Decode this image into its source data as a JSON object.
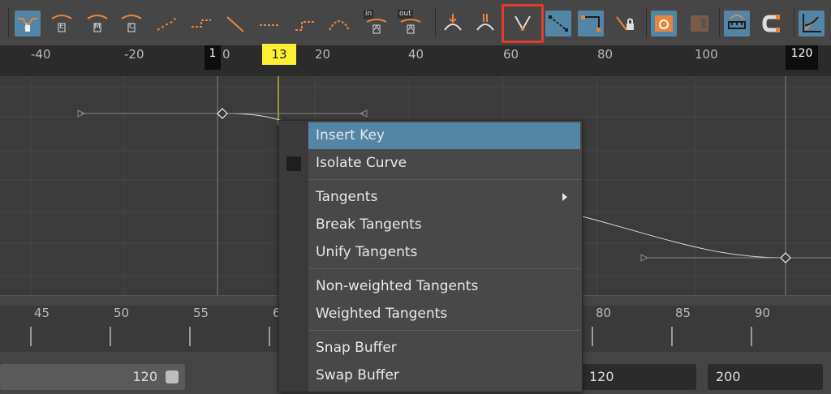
{
  "toolbar": {
    "tools": [
      {
        "icon": "key-tangent-auto-icon",
        "label": "A",
        "active": true
      },
      {
        "icon": "key-tangent-spline-icon",
        "label": "E",
        "active": false
      },
      {
        "icon": "key-tangent-clamped-icon",
        "label": "M",
        "active": false
      },
      {
        "icon": "key-tangent-linear-icon",
        "label": "C",
        "active": false
      },
      {
        "icon": "tangent-flat-icon",
        "active": false
      },
      {
        "icon": "tangent-step-icon",
        "active": false
      },
      {
        "icon": "tangent-linear-icon",
        "active": false
      },
      {
        "icon": "tangent-step-next-icon",
        "active": false
      },
      {
        "icon": "tangent-plateau-icon",
        "active": false
      },
      {
        "icon": "tangent-fixed-icon",
        "active": false
      },
      {
        "icon": "in-tangent-icon",
        "tag": "in",
        "label": "A",
        "active": false
      },
      {
        "icon": "out-tangent-icon",
        "tag": "out",
        "label": "A",
        "active": false
      },
      {
        "icon": "break-tangents-icon",
        "active": false
      },
      {
        "icon": "unify-tangents-icon",
        "active": false
      },
      {
        "icon": "insert-key-tool-icon",
        "active": false,
        "highlighted": true
      },
      {
        "icon": "buffer-curve-icon",
        "active": true
      },
      {
        "icon": "curve-selection-icon",
        "active": true
      },
      {
        "icon": "lock-tangent-icon",
        "active": false
      },
      {
        "icon": "frame-playback-icon",
        "active": true
      },
      {
        "icon": "snap-disabled-icon",
        "active": false
      },
      {
        "icon": "retime-tool-icon",
        "active": true
      },
      {
        "icon": "magnet-icon",
        "active": false
      },
      {
        "icon": "graph-view-icon",
        "active": true
      }
    ]
  },
  "time_ruler": {
    "labels": [
      "-40",
      "-20",
      "0",
      "20",
      "40",
      "60",
      "80",
      "100"
    ],
    "start_marker": "1",
    "current_frame": "13",
    "end_marker": "120"
  },
  "bottom_ruler": {
    "labels": [
      "45",
      "50",
      "55",
      "6",
      "80",
      "85",
      "90"
    ]
  },
  "range": {
    "start_value": "120",
    "end_value": "120",
    "max_value": "200"
  },
  "context_menu": {
    "items": [
      {
        "label": "Insert Key",
        "selected": true
      },
      {
        "label": "Isolate Curve",
        "checkbox": true
      },
      {
        "label": "Tangents",
        "submenu": true
      },
      {
        "label": "Break Tangents"
      },
      {
        "label": "Unify Tangents"
      },
      {
        "label": "Non-weighted Tangents"
      },
      {
        "label": "Weighted Tangents"
      },
      {
        "label": "Snap Buffer"
      },
      {
        "label": "Swap Buffer"
      }
    ]
  },
  "colors": {
    "accent": "#5285a6",
    "highlight": "#e23b2a",
    "current_frame_marker": "#ffef33",
    "icon_orange": "#e9843a"
  }
}
